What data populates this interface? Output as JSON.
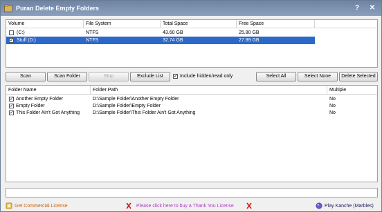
{
  "app": {
    "title": "Puran Delete Empty Folders",
    "help_glyph": "?",
    "close_glyph": "✕"
  },
  "volumes": {
    "columns": [
      "Volume",
      "File System",
      "Total Space",
      "Free Space"
    ],
    "rows": [
      {
        "checked": false,
        "volume": "(C:)",
        "file_system": "NTFS",
        "total": "43.60 GB",
        "free": "25.80 GB",
        "selected": false
      },
      {
        "checked": true,
        "volume": "Stuff (D:)",
        "file_system": "NTFS",
        "total": "32.74 GB",
        "free": "27.89 GB",
        "selected": true
      }
    ]
  },
  "toolbar": {
    "scan": "Scan",
    "scan_folder": "Scan Folder",
    "stop": "Stop",
    "exclude_list": "Exclude List",
    "include_hidden": "Include hidden/read only",
    "include_hidden_checked": true,
    "select_all": "Select All",
    "select_none": "Select None",
    "delete_selected": "Delete Selected"
  },
  "folders": {
    "columns": [
      "Folder Name",
      "Folder Path",
      "Multiple"
    ],
    "rows": [
      {
        "checked": true,
        "name": "Another Empty Folder",
        "path": "D:\\Sample Folder\\Another Empty Folder",
        "multiple": "No"
      },
      {
        "checked": true,
        "name": "Empty Folder",
        "path": "D:\\Sample Folder\\Empty Folder",
        "multiple": "No"
      },
      {
        "checked": true,
        "name": "This Folder Ain't Got Anything",
        "path": "D:\\Sample Folder\\This Folder Ain't Got Anything",
        "multiple": "No"
      }
    ]
  },
  "status": {
    "text": ""
  },
  "footer": {
    "commercial": "Get Commercial License",
    "thank_you": "Please click here to buy a Thank You License",
    "play": "Play Kanche (Marbles)"
  },
  "colors": {
    "title_bar": "#7a8fae",
    "selection": "#2c68c8",
    "commercial_text": "#c8640a",
    "thank_you_text": "#b03cc8",
    "ribbon": "#d01818"
  }
}
